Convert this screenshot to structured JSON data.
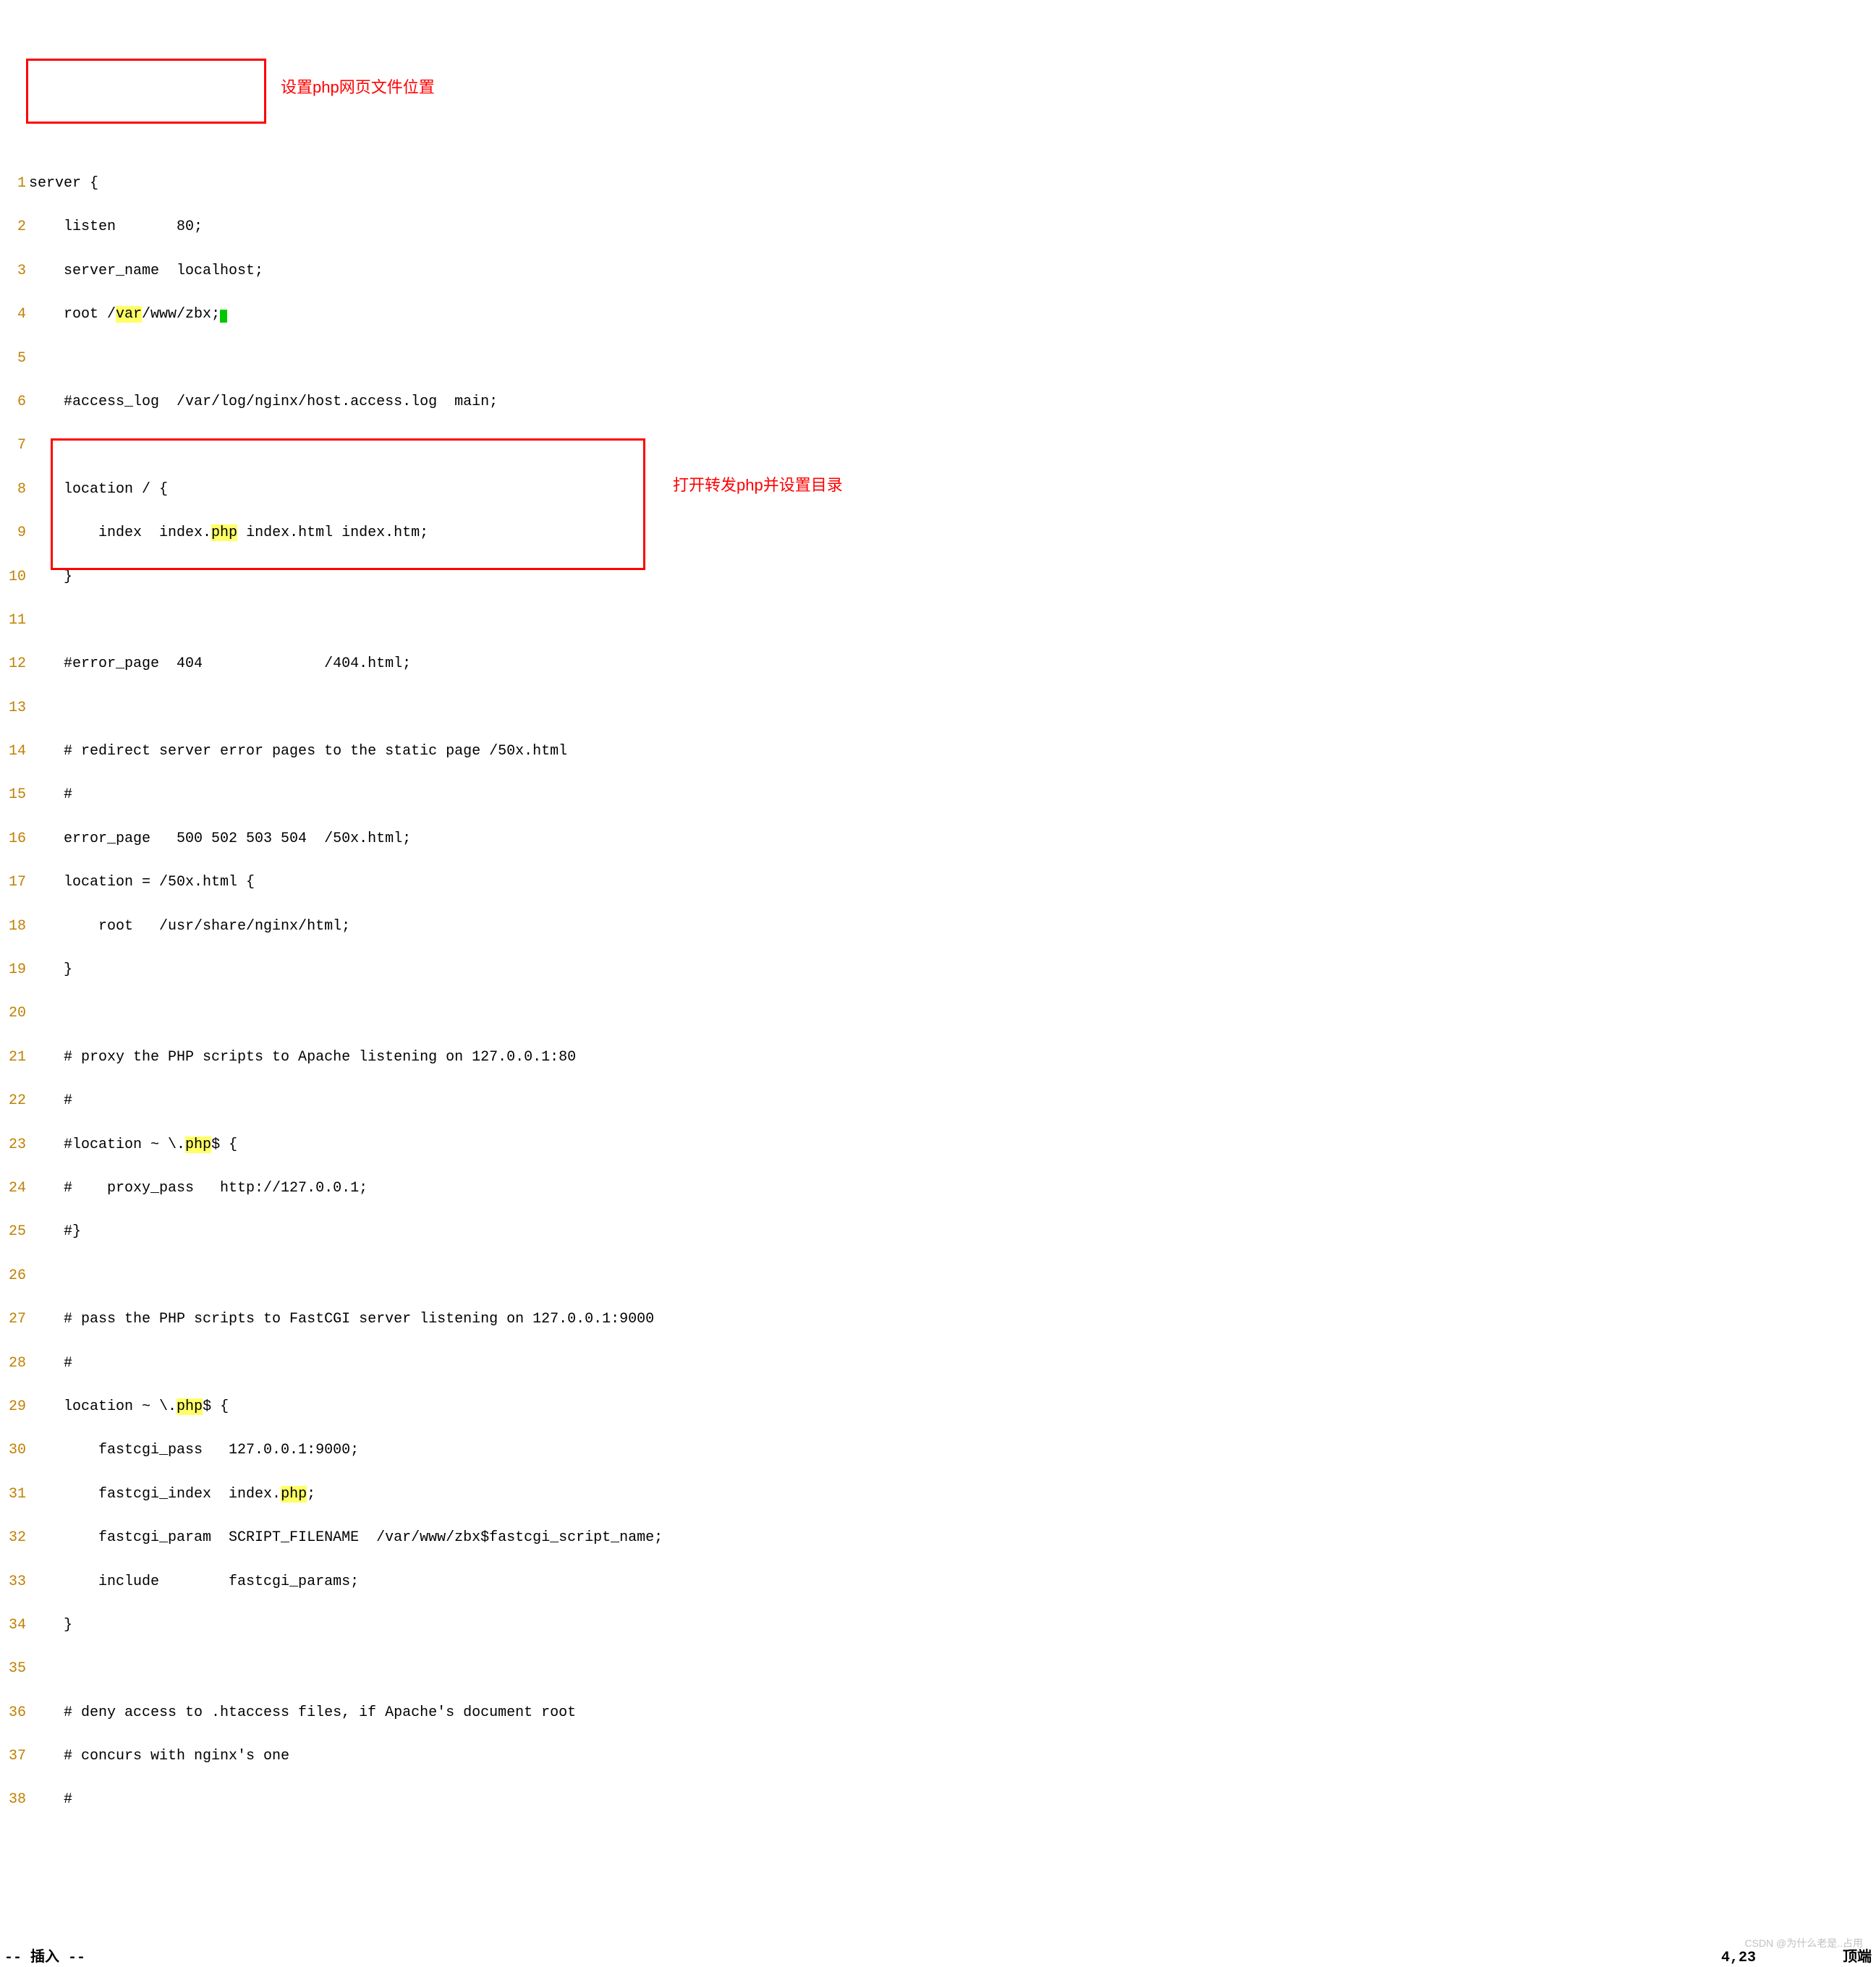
{
  "annotations": {
    "a1": "设置php网页文件位置",
    "a2": "打开转发php并设置目录"
  },
  "status": {
    "mode": "-- 插入 --",
    "pos": "4,23",
    "right": "顶端"
  },
  "watermark": "CSDN @为什么老是..占用",
  "lines": {
    "l1_a": "server {",
    "l2_a": "    listen       80;",
    "l3_a": "    server_name  localhost;",
    "l4_a": "    root /",
    "l4_b": "var",
    "l4_c": "/www/zbx;",
    "l5_a": "",
    "l6_a": "    #access_log  /var/log/nginx/host.access.log  main;",
    "l7_a": "",
    "l8_a": "    location / {",
    "l9_a": "        index  index.",
    "l9_b": "php",
    "l9_c": " index.html index.htm;",
    "l10_a": "    }",
    "l11_a": "",
    "l12_a": "    #error_page  404              /404.html;",
    "l13_a": "",
    "l14_a": "    # redirect server error pages to the static page /50x.html",
    "l15_a": "    #",
    "l16_a": "    error_page   500 502 503 504  /50x.html;",
    "l17_a": "    location = /50x.html {",
    "l18_a": "        root   /usr/share/nginx/html;",
    "l19_a": "    }",
    "l20_a": "",
    "l21_a": "    # proxy the PHP scripts to Apache listening on 127.0.0.1:80",
    "l22_a": "    #",
    "l23_a": "    #location ~ \\.",
    "l23_b": "php",
    "l23_c": "$ {",
    "l24_a": "    #    proxy_pass   http://127.0.0.1;",
    "l25_a": "    #}",
    "l26_a": "",
    "l27_a": "    # pass the PHP scripts to FastCGI server listening on 127.0.0.1:9000",
    "l28_a": "    #",
    "l29_a": "    location ~ \\.",
    "l29_b": "php",
    "l29_c": "$ {",
    "l30_a": "        fastcgi_pass   127.0.0.1:9000;",
    "l31_a": "        fastcgi_index  index.",
    "l31_b": "php",
    "l31_c": ";",
    "l32_a": "        fastcgi_param  SCRIPT_FILENAME  /var/www/zbx$fastcgi_script_name;",
    "l33_a": "        include        fastcgi_params;",
    "l34_a": "    }",
    "l35_a": "",
    "l36_a": "    # deny access to .htaccess files, if Apache's document root",
    "l37_a": "    # concurs with nginx's one",
    "l38_a": "    #"
  },
  "gutter": {
    "g1": "1",
    "g2": "2",
    "g3": "3",
    "g4": "4",
    "g5": "5",
    "g6": "6",
    "g7": "7",
    "g8": "8",
    "g9": "9",
    "g10": "10",
    "g11": "11",
    "g12": "12",
    "g13": "13",
    "g14": "14",
    "g15": "15",
    "g16": "16",
    "g17": "17",
    "g18": "18",
    "g19": "19",
    "g20": "20",
    "g21": "21",
    "g22": "22",
    "g23": "23",
    "g24": "24",
    "g25": "25",
    "g26": "26",
    "g27": "27",
    "g28": "28",
    "g29": "29",
    "g30": "30",
    "g31": "31",
    "g32": "32",
    "g33": "33",
    "g34": "34",
    "g35": "35",
    "g36": "36",
    "g37": "37",
    "g38": "38"
  }
}
